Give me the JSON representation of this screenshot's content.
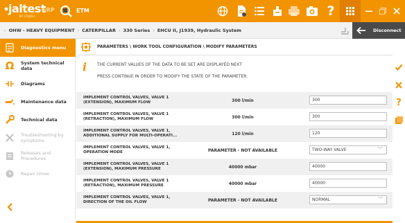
{
  "topbar": {
    "logo": "jaltest",
    "logo_sub": "BY COJALI",
    "grp_label": "GRP",
    "etm_label": "ETM",
    "icons": [
      "globe-icon",
      "document-icon",
      "list-icon",
      "delete-icon",
      "printer-icon",
      "camera-icon",
      "help-icon",
      "apps-icon",
      "minimize-icon",
      "restore-icon",
      "close-icon"
    ],
    "accent": "#f29400",
    "dark_accent": "#e07f00"
  },
  "breadcrumb": {
    "items": [
      "OHW - HEAVY EQUIPMENT",
      "CATERPILLAR",
      "330 Series",
      "EHCU II, J1939, Hydraulic System"
    ]
  },
  "disconnect": {
    "label": "Disconnect"
  },
  "sidebar": {
    "items": [
      {
        "label": "Diagnostics menu",
        "icon": "diagnostics-icon",
        "state": "active"
      },
      {
        "label": "System technical data",
        "icon": "ohm-icon",
        "state": "normal"
      },
      {
        "label": "Diagrams",
        "icon": "diagram-icon",
        "state": "normal"
      },
      {
        "label": "Maintenance data",
        "icon": "oil-can-icon",
        "state": "normal"
      },
      {
        "label": "Technical data",
        "icon": "wrench-icon",
        "state": "normal"
      },
      {
        "label": "Troubleshooting by symptoms",
        "icon": "tools-icon",
        "state": "disabled"
      },
      {
        "label": "Releases and Procedures",
        "icon": "releases-icon",
        "state": "disabled"
      },
      {
        "label": "Repair times",
        "icon": "repair-times-icon",
        "state": "disabled"
      }
    ]
  },
  "main": {
    "title": "PARAMETERS \\ WORK TOOL CONFIGURATION \\ MODIFY PARAMETERS",
    "info_line1": "THE CURRENT VALUES OF THE DATA TO BE SET ARE DISPLAYED NEXT",
    "info_line2": "PRESS CONTINUE IN ORDER TO MODIFY THE STATE OF THE PARAMETER.",
    "rows": [
      {
        "name1": "IMPLEMENT CONTROL VALVES, VALVE 1",
        "name2": "(EXTENSION), MAXIMUM FLOW",
        "value": "300 l/min",
        "field": "300",
        "dropdown": false
      },
      {
        "name1": "IMPLEMENT CONTROL VALVES, VALVE 1",
        "name2": "(RETRACTION), MAXIMUM FLOW",
        "value": "300 l/min",
        "field": "300",
        "dropdown": false
      },
      {
        "name1": "IMPLEMENT CONTROL VALVES, VALVE 1,",
        "name2": "ADDITIONAL SUPPLY FOR MULTI-OPERATI...",
        "value": "120 l/min",
        "field": "120",
        "dropdown": false
      },
      {
        "name1": "IMPLEMENT CONTROL VALVES, VALVE 1,",
        "name2": "OPERATION MODE",
        "value": "PARAMETER - NOT AVAILABLE",
        "field": "TWO-WAY VALVE",
        "dropdown": true
      },
      {
        "name1": "IMPLEMENT CONTROL VALVES, VALVE 1",
        "name2": "(EXTENSION), MAXIMUM PRESSURE",
        "value": "40000 mbar",
        "field": "40000",
        "dropdown": false
      },
      {
        "name1": "IMPLEMENT CONTROL VALVES, VALVE 1",
        "name2": "(RETRACTION), MAXIMUM PRESSURE",
        "value": "40000 mbar",
        "field": "40000",
        "dropdown": false
      },
      {
        "name1": "IMPLEMENT CONTROL VALVES, VALVE 1,",
        "name2": "DIRECTION OF THE OIL FLOW",
        "value": "PARAMETER - NOT AVAILABLE",
        "field": "NORMAL",
        "dropdown": true
      }
    ]
  },
  "actions": [
    "check-icon",
    "cancel-icon",
    "help-icon",
    "book-icon"
  ]
}
